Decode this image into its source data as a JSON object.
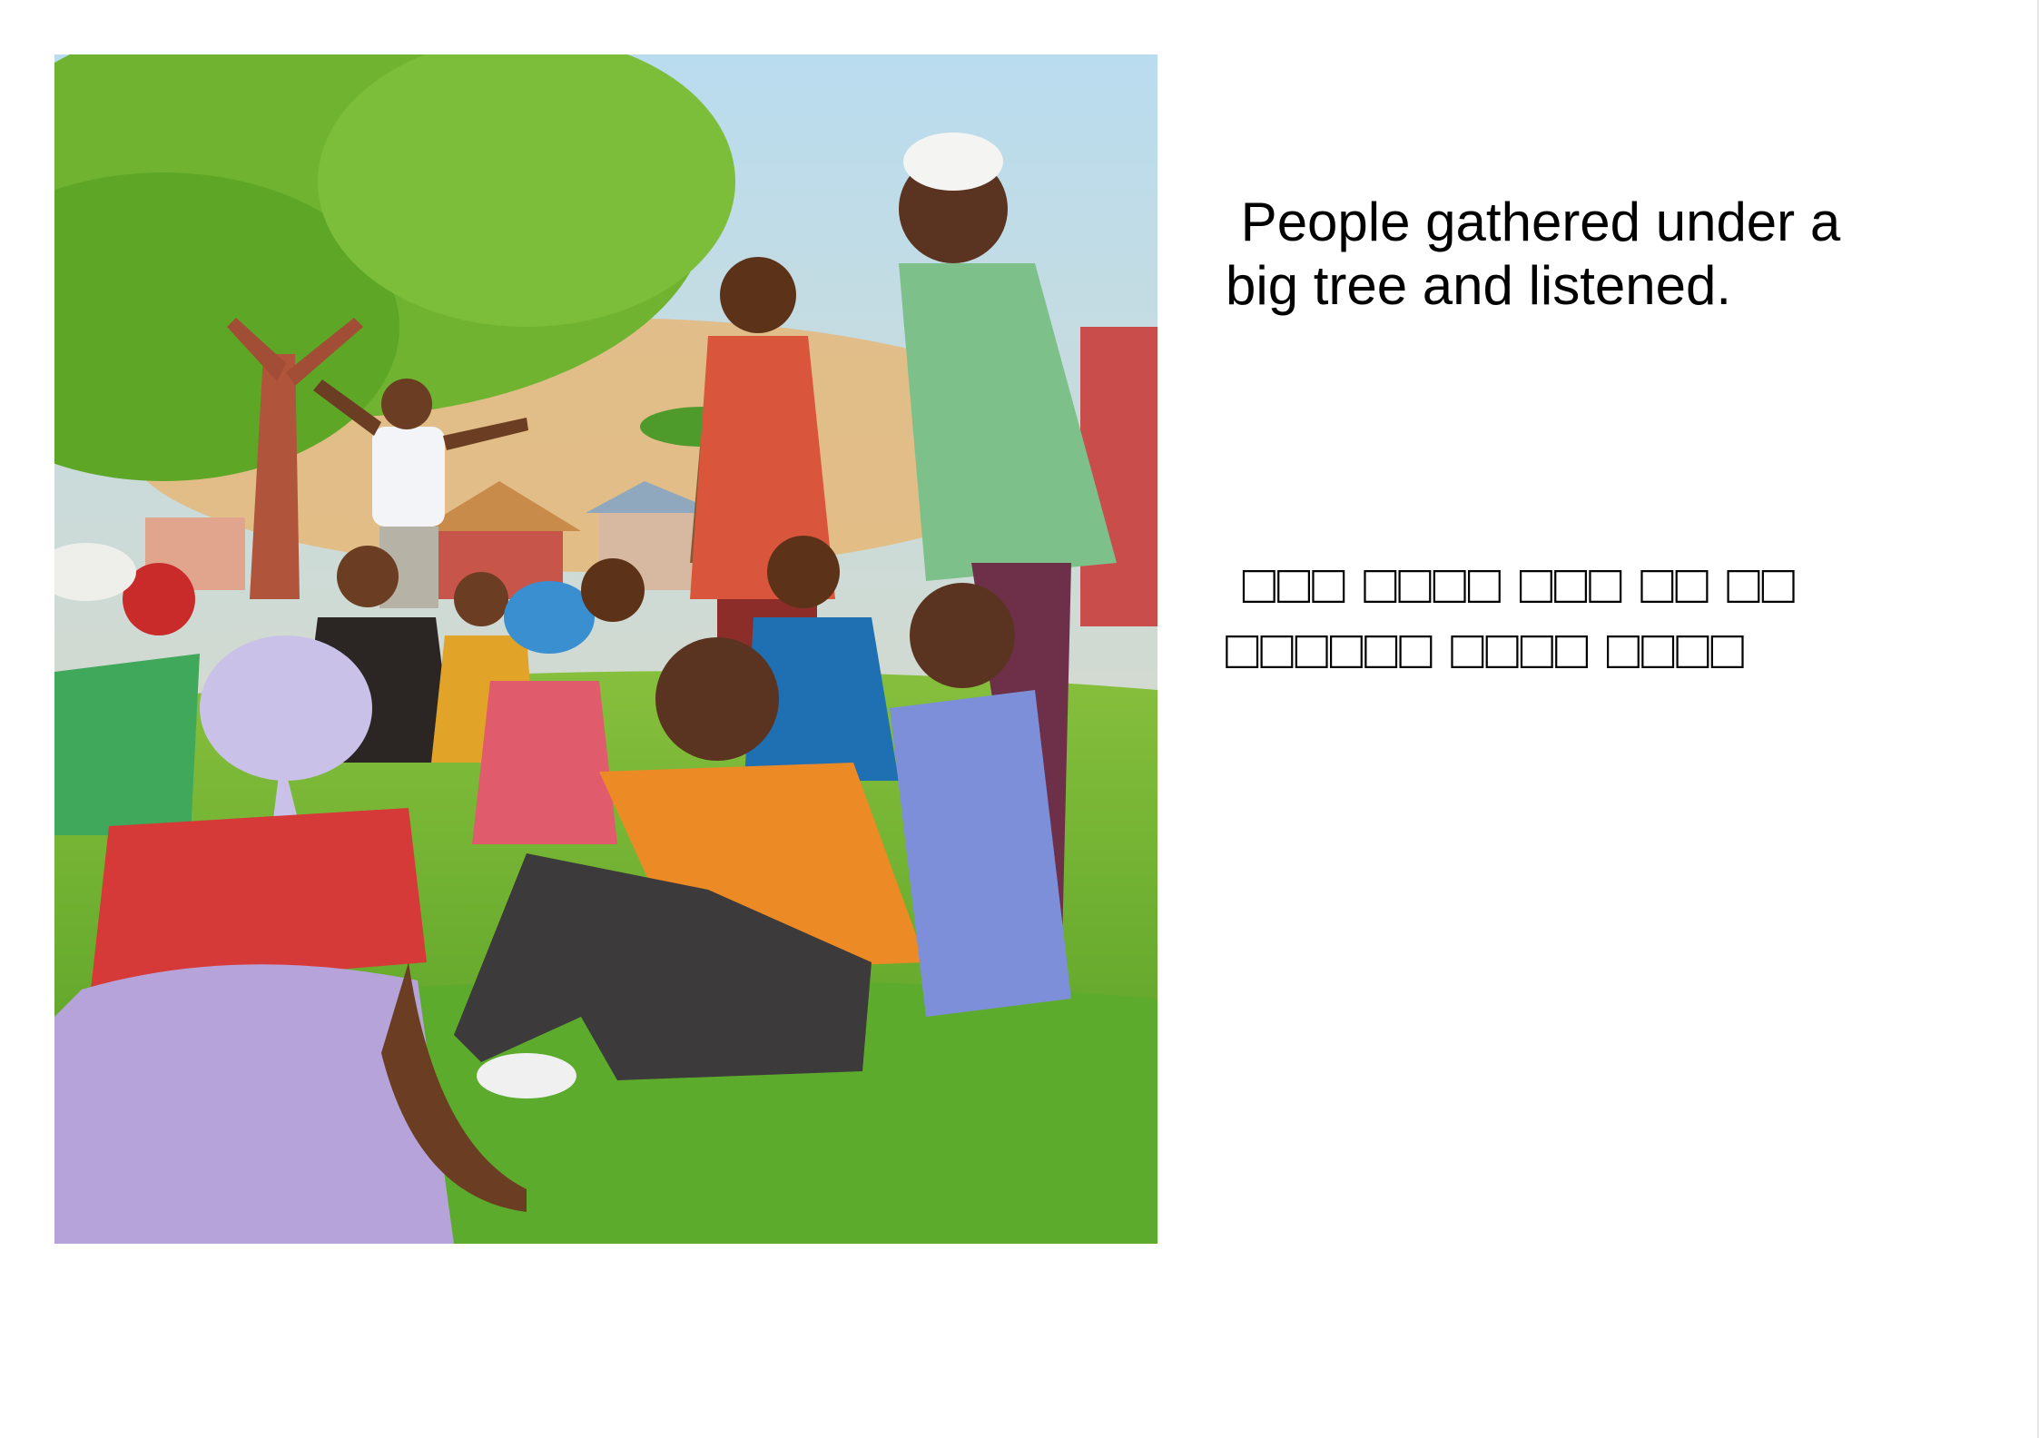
{
  "page": {
    "caption_english": " People gathered under a\nbig tree and listened.",
    "caption_second_language": " □□□ □□□□ □□□ □□ □□\n□□□□□□ □□□□ □□□□"
  },
  "illustration": {
    "subject": "people gathered under a big tree listening to a speaker"
  }
}
